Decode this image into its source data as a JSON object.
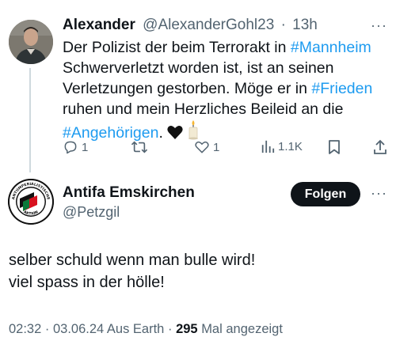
{
  "tweet1": {
    "author_name": "Alexander",
    "handle": "@AlexanderGohl23",
    "separator": "·",
    "time": "13h",
    "more": "···",
    "text": {
      "p1": "Der Polizist der beim Terrorakt in ",
      "tag1": "#Mannheim",
      "p2": " Schwerverletzt worden ist, ist an seinen Verletzungen gestorben. Möge er in ",
      "tag2": "#Frieden",
      "p3": " ruhen und mein Herzliches Beileid an die ",
      "tag3": "#Angehörigen",
      "p4": ". "
    },
    "emojis": [
      "black-heart-emoji",
      "candle-emoji"
    ],
    "actions": {
      "replies": "1",
      "retweets": "",
      "likes": "1",
      "views": "1.1K"
    }
  },
  "tweet2": {
    "author_name": "Antifa Emskirchen",
    "handle": "@Petzgil",
    "follow_label": "Folgen",
    "more": "···",
    "avatar_logo_text": "ANTIIMPERIALISTISCHE AKTION",
    "text_lines": [
      "selber schuld wenn man bulle wird!",
      "viel spass in der hölle!"
    ],
    "meta": {
      "time": "02:32",
      "date": "03.06.24",
      "location": "Aus Earth",
      "views_count": "295",
      "views_label": "Mal angezeigt",
      "separator": "·"
    }
  },
  "colors": {
    "link": "#1d9bf0",
    "secondary_text": "#536471",
    "primary_text": "#0f1419",
    "thread_line": "#cfd9de",
    "button_bg": "#0f1419"
  }
}
